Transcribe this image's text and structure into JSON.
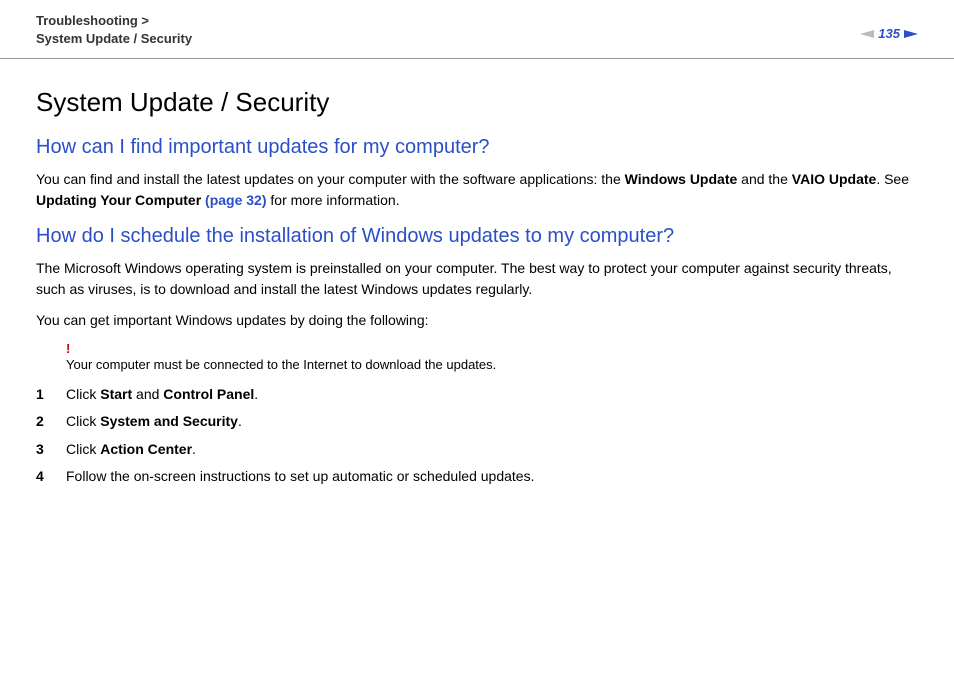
{
  "breadcrumb": {
    "line1": "Troubleshooting >",
    "line2": "System Update / Security"
  },
  "pageNumber": "135",
  "title": "System Update / Security",
  "section1": {
    "heading": "How can I find important updates for my computer?",
    "p1_before": "You can find and install the latest updates on your computer with the software applications: the ",
    "p1_bold1": "Windows Update",
    "p1_mid1": " and the ",
    "p1_bold2": "VAIO Update",
    "p1_mid2": ". See ",
    "p1_bold3": "Updating Your Computer ",
    "p1_link": "(page 32)",
    "p1_after": " for more information."
  },
  "section2": {
    "heading": "How do I schedule the installation of Windows updates to my computer?",
    "p1": "The Microsoft Windows operating system is preinstalled on your computer. The best way to protect your computer against security threats, such as viruses, is to download and install the latest Windows updates regularly.",
    "p2": "You can get important Windows updates by doing the following:",
    "warning_mark": "!",
    "warning_text": "Your computer must be connected to the Internet to download the updates.",
    "steps": [
      {
        "num": "1",
        "pre": "Click ",
        "b1": "Start",
        "mid": " and ",
        "b2": "Control Panel",
        "post": "."
      },
      {
        "num": "2",
        "pre": "Click ",
        "b1": "System and Security",
        "mid": "",
        "b2": "",
        "post": "."
      },
      {
        "num": "3",
        "pre": "Click ",
        "b1": "Action Center",
        "mid": "",
        "b2": "",
        "post": "."
      },
      {
        "num": "4",
        "pre": "Follow the on-screen instructions to set up automatic or scheduled updates.",
        "b1": "",
        "mid": "",
        "b2": "",
        "post": ""
      }
    ]
  }
}
